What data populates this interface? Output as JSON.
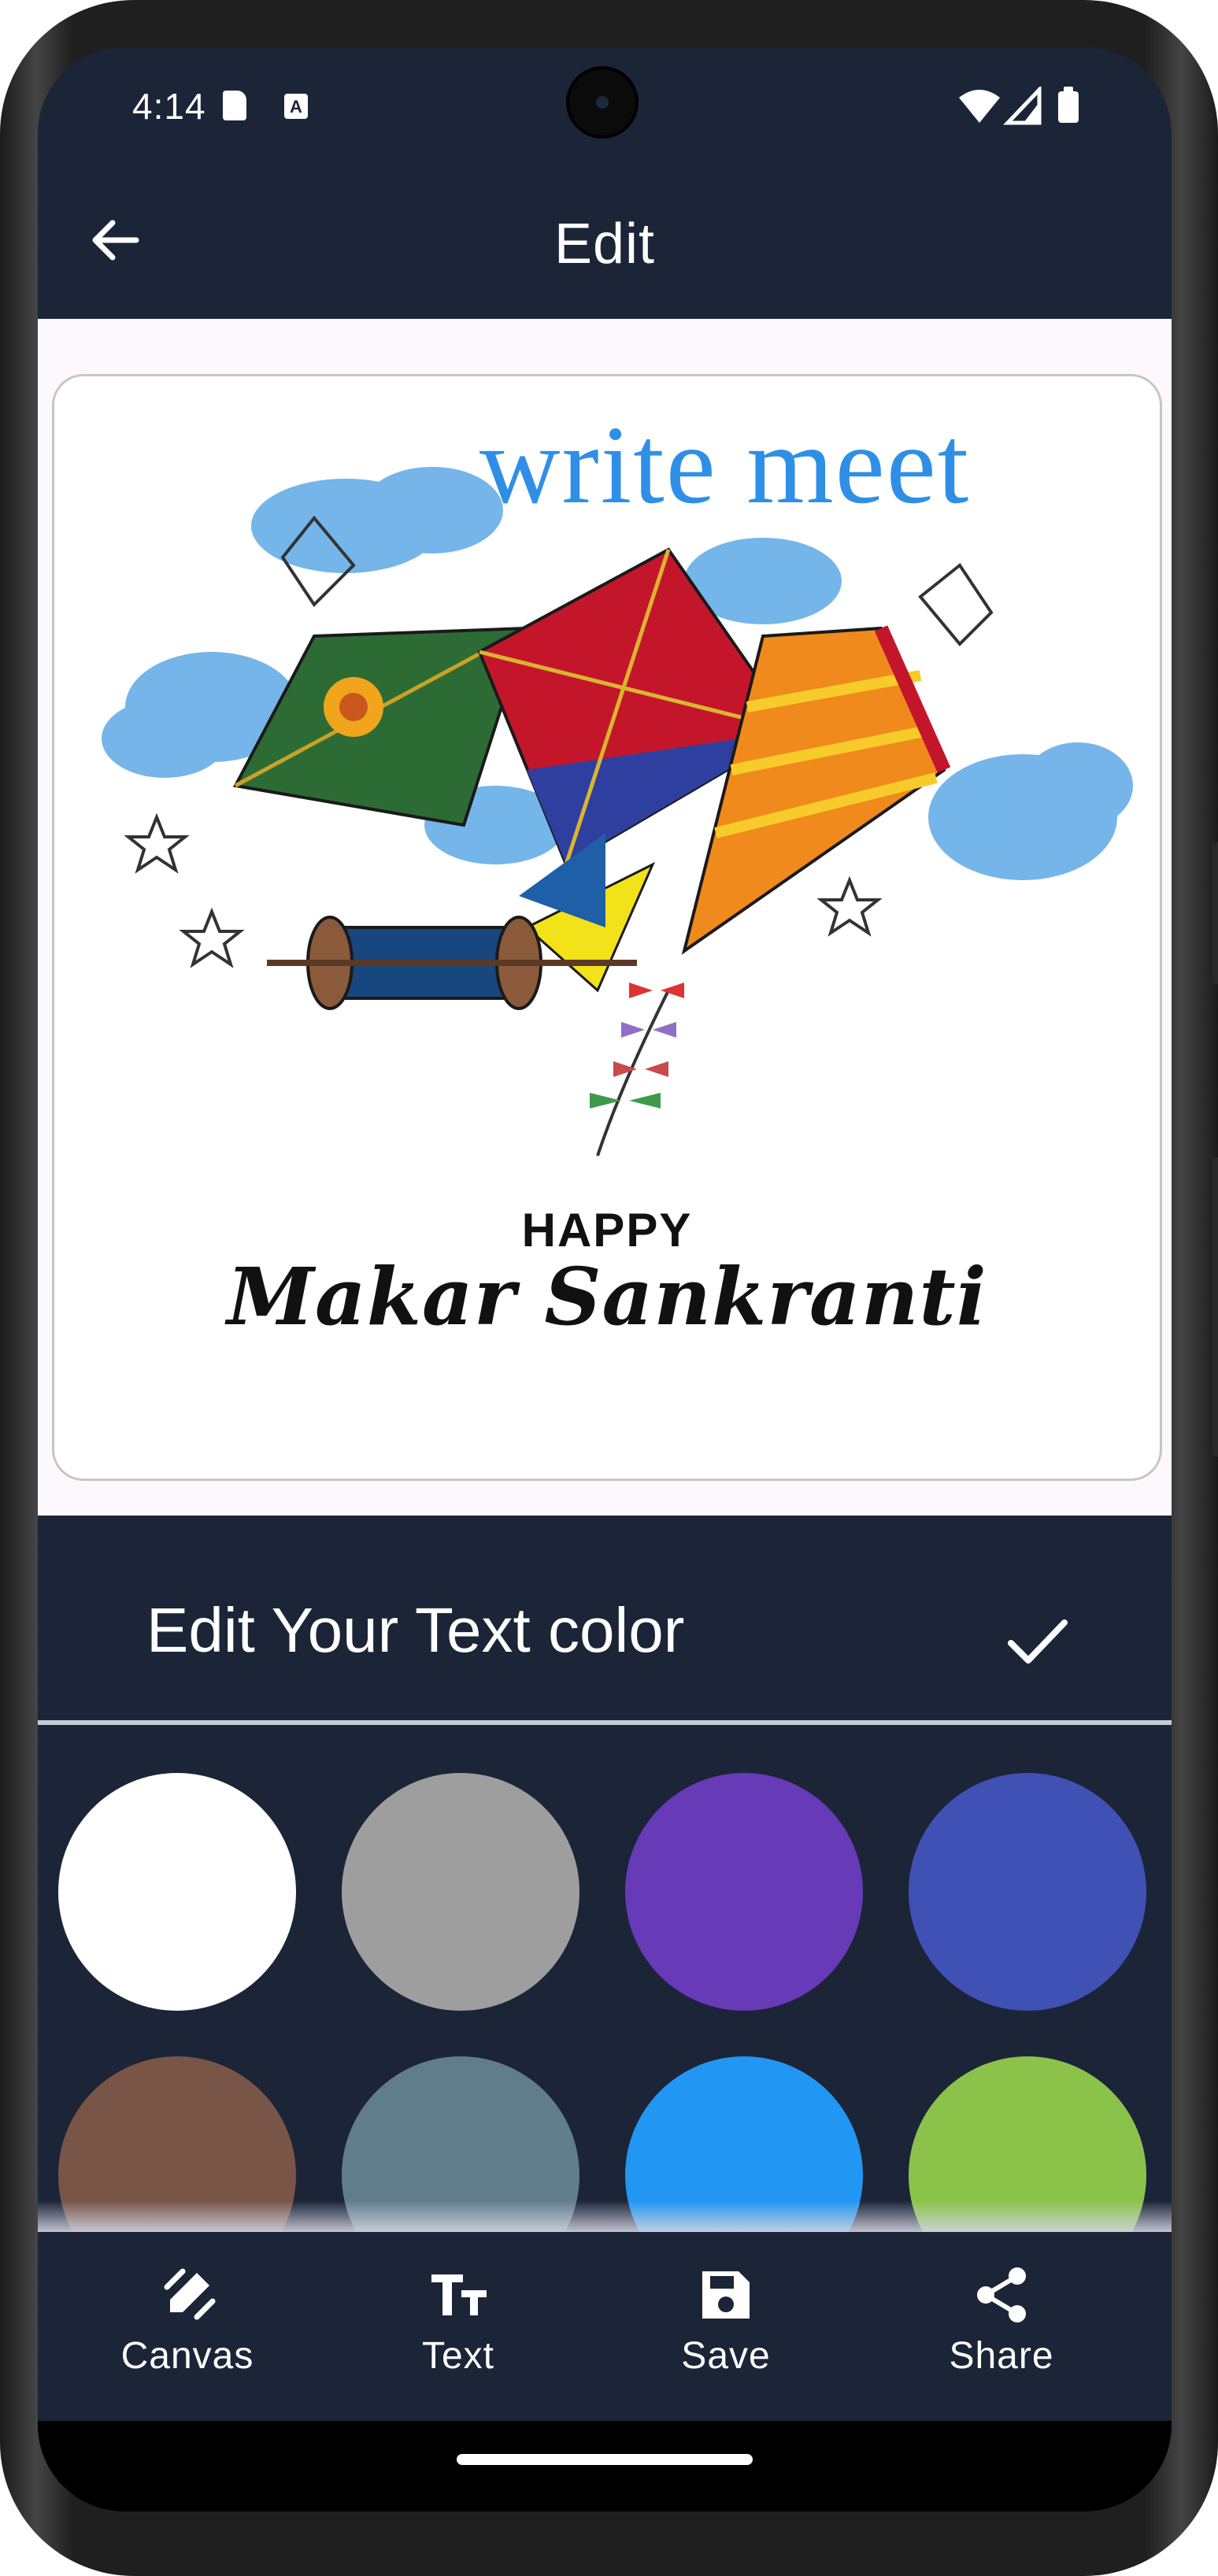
{
  "status_bar": {
    "time": "4:14",
    "sd_card_icon": "sd-card-icon",
    "app_notification_icon": "a-icon",
    "notification_letter": "A",
    "wifi_icon": "wifi-icon",
    "signal_icon": "signal-icon",
    "battery_icon": "battery-icon"
  },
  "app_bar": {
    "title": "Edit",
    "back_icon": "arrow-left-icon"
  },
  "card": {
    "overlay_text": "write meet",
    "overlay_text_color": "#2f8fe6",
    "greeting_line1": "HAPPY",
    "greeting_line2": "Makar Sankranti",
    "illustration": "kites-illustration"
  },
  "color_sheet": {
    "title": "Edit Your Text color",
    "confirm_icon": "check-icon",
    "swatches": [
      {
        "name": "white",
        "color": "#ffffff"
      },
      {
        "name": "grey",
        "color": "#9e9e9e"
      },
      {
        "name": "deep-purple",
        "color": "#673ab7"
      },
      {
        "name": "indigo",
        "color": "#3f51b5"
      },
      {
        "name": "brown",
        "color": "#795548"
      },
      {
        "name": "blue-grey",
        "color": "#607d8b"
      },
      {
        "name": "blue",
        "color": "#2196f3"
      },
      {
        "name": "light-green",
        "color": "#8bc34a"
      }
    ]
  },
  "bottom_nav": {
    "items": [
      {
        "label": "Canvas",
        "icon": "brush-icon"
      },
      {
        "label": "Text",
        "icon": "text-size-icon"
      },
      {
        "label": "Save",
        "icon": "save-icon"
      },
      {
        "label": "Share",
        "icon": "share-icon"
      }
    ]
  },
  "colors": {
    "app_background": "#1c2438",
    "content_background": "#fdf8fc",
    "accent_text": "#2f8fe6"
  }
}
